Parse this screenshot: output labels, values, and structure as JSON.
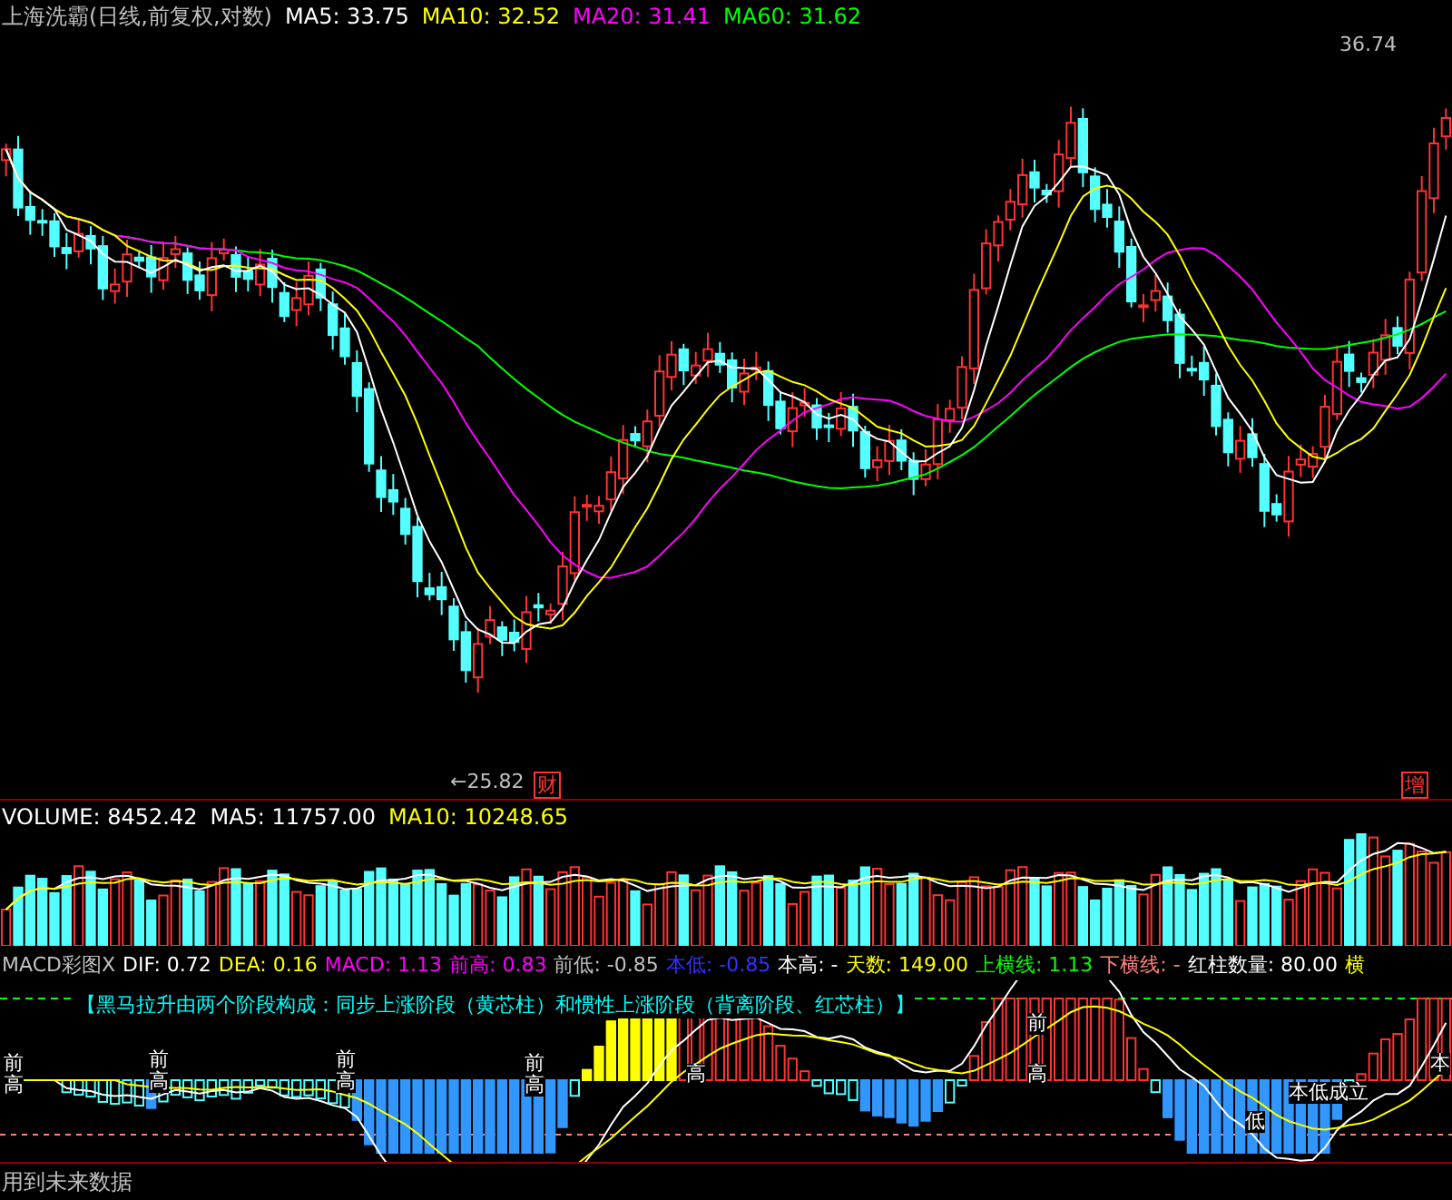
{
  "price_panel": {
    "title": "上海洗霸(日线,前复权,对数)",
    "indicators": [
      {
        "label": "MA5: 33.75",
        "color": "#ffffff"
      },
      {
        "label": "MA10: 32.52",
        "color": "#ffff00"
      },
      {
        "label": "MA20: 31.41",
        "color": "#ff00ff"
      },
      {
        "label": "MA60: 31.62",
        "color": "#00ff00"
      }
    ],
    "high_label": "36.74",
    "low_label": "←25.82",
    "tags": [
      "财",
      "增"
    ]
  },
  "volume_panel": {
    "indicators": [
      {
        "label": "VOLUME: 8452.42",
        "color": "#ffffff"
      },
      {
        "label": "MA5: 11757.00",
        "color": "#ffffff"
      },
      {
        "label": "MA10: 10248.65",
        "color": "#ffff00"
      }
    ]
  },
  "macd_panel": {
    "indicators": [
      {
        "label": "MACD彩图X",
        "color": "#c0c0c0"
      },
      {
        "label": "DIF: 0.72",
        "color": "#ffffff"
      },
      {
        "label": "DEA: 0.16",
        "color": "#ffff00"
      },
      {
        "label": "MACD: 1.13",
        "color": "#ff00ff"
      },
      {
        "label": "前高: 0.83",
        "color": "#ff00ff"
      },
      {
        "label": "前低: -0.85",
        "color": "#c0c0c0"
      },
      {
        "label": "本低: -0.85",
        "color": "#3232ff"
      },
      {
        "label": "本高: -",
        "color": "#ffffff"
      },
      {
        "label": "天数: 149.00",
        "color": "#ffff00"
      },
      {
        "label": "上横线: 1.13",
        "color": "#00ff00"
      },
      {
        "label": "下横线: -",
        "color": "#ff8080"
      },
      {
        "label": "红柱数量: 80.00",
        "color": "#ffffff"
      },
      {
        "label": "横",
        "color": "#ffff00"
      }
    ],
    "banner": "【黑马拉升由两个阶段构成：同步上涨阶段（黄芯柱）和惯性上涨阶段（背离阶段、红芯柱）】",
    "markers": [
      "前高",
      "前高",
      "前高",
      "前高",
      "高",
      "前",
      "高",
      "低",
      "本低成立",
      "本"
    ]
  },
  "footer_note": "用到未来数据"
}
